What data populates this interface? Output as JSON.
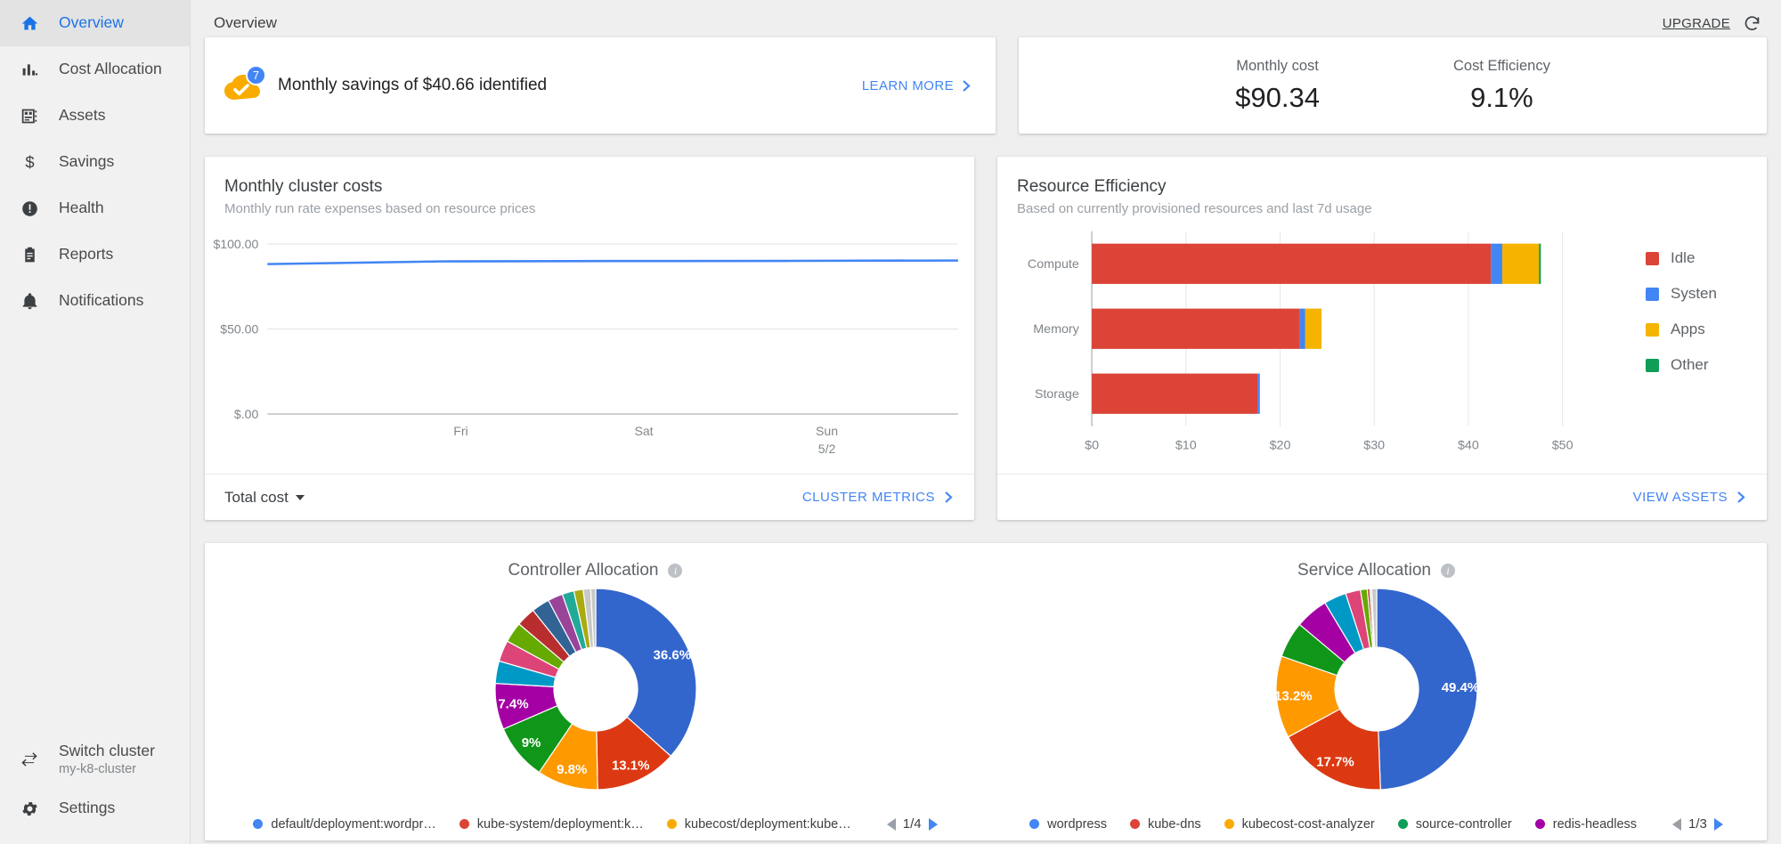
{
  "sidebar": {
    "items": [
      {
        "label": "Overview",
        "icon": "home-icon",
        "active": true
      },
      {
        "label": "Cost Allocation",
        "icon": "bar-chart-icon",
        "active": false
      },
      {
        "label": "Assets",
        "icon": "assets-icon",
        "active": false
      },
      {
        "label": "Savings",
        "icon": "dollar-icon",
        "active": false
      },
      {
        "label": "Health",
        "icon": "alert-icon",
        "active": false
      },
      {
        "label": "Reports",
        "icon": "clipboard-icon",
        "active": false
      },
      {
        "label": "Notifications",
        "icon": "bell-icon",
        "active": false
      }
    ],
    "switch_cluster": {
      "title": "Switch cluster",
      "subtitle": "my-k8-cluster",
      "icon": "swap-arrows-icon"
    },
    "settings": {
      "label": "Settings",
      "icon": "gear-icon"
    }
  },
  "header": {
    "breadcrumb": "Overview",
    "upgrade_label": "UPGRADE",
    "refresh_icon": "refresh-icon"
  },
  "savings": {
    "badge_count": "7",
    "message": "Monthly savings of $40.66 identified",
    "learn_more_label": "LEARN MORE",
    "icon": "cloud-check-icon",
    "badge_color": "#4285f4",
    "cloud_color": "#f9ab00"
  },
  "summary": {
    "metrics": [
      {
        "label": "Monthly cost",
        "value": "$90.34"
      },
      {
        "label": "Cost Efficiency",
        "value": "9.1%"
      }
    ]
  },
  "cluster_costs": {
    "title": "Monthly cluster costs",
    "subtitle": "Monthly run rate expenses based on resource prices",
    "footer_select": "Total cost",
    "footer_link": "CLUSTER METRICS"
  },
  "resource_efficiency": {
    "title": "Resource Efficiency",
    "subtitle": "Based on currently provisioned resources and last 7d usage",
    "footer_link": "VIEW ASSETS"
  },
  "controller_allocation": {
    "title": "Controller Allocation",
    "info_icon": "info-icon",
    "page": "1/4",
    "legend": [
      {
        "label": "default/deployment:wordpr…",
        "color": "#4285f4"
      },
      {
        "label": "kube-system/deployment:k…",
        "color": "#db4437"
      },
      {
        "label": "kubecost/deployment:kube…",
        "color": "#f9ab00"
      }
    ]
  },
  "service_allocation": {
    "title": "Service Allocation",
    "info_icon": "info-icon",
    "page": "1/3",
    "legend": [
      {
        "label": "wordpress",
        "color": "#4285f4"
      },
      {
        "label": "kube-dns",
        "color": "#db4437"
      },
      {
        "label": "kubecost-cost-analyzer",
        "color": "#f9ab00"
      },
      {
        "label": "source-controller",
        "color": "#0f9d58"
      },
      {
        "label": "redis-headless",
        "color": "#a400a4"
      }
    ]
  },
  "chart_data": [
    {
      "type": "line",
      "title": "Monthly cluster costs",
      "subtitle": "Monthly run rate expenses based on resource prices",
      "xlabel": "",
      "ylabel": "",
      "x": [
        "",
        "Fri",
        "Sat",
        "Sun 5/2",
        ""
      ],
      "tick_labels": [
        "Fri",
        "Sat",
        "Sun",
        "5/2"
      ],
      "values": [
        88.2,
        89.8,
        90.0,
        90.1,
        90.34
      ],
      "ylim": [
        0,
        100
      ],
      "yticks": [
        0,
        50,
        100
      ],
      "ytick_labels": [
        "$.00",
        "$50.00",
        "$100.00"
      ],
      "series_color": "#4285f4",
      "grid": true,
      "legend": "none"
    },
    {
      "type": "bar",
      "orientation": "horizontal",
      "stacked": true,
      "title": "Resource Efficiency",
      "subtitle": "Based on currently provisioned resources and last 7d usage",
      "categories": [
        "Compute",
        "Memory",
        "Storage"
      ],
      "series": [
        {
          "name": "Idle",
          "color": "#db4437",
          "values": [
            42.4,
            22.1,
            17.6
          ]
        },
        {
          "name": "Systen",
          "color": "#4285f4",
          "values": [
            1.2,
            0.55,
            0.25
          ]
        },
        {
          "name": "Apps",
          "color": "#f4b400",
          "values": [
            3.9,
            1.75,
            0.0
          ]
        },
        {
          "name": "Other",
          "color": "#0f9d58",
          "values": [
            0.2,
            0.0,
            0.0
          ]
        }
      ],
      "xlim": [
        0,
        55
      ],
      "xticks": [
        0,
        10,
        20,
        30,
        40,
        50
      ],
      "xtick_labels": [
        "$0",
        "$10",
        "$20",
        "$30",
        "$40",
        "$50"
      ],
      "grid": true,
      "legend": "right"
    },
    {
      "type": "pie",
      "variant": "donut",
      "title": "Controller Allocation",
      "labels": [
        "default/deployment:wordpr…",
        "kube-system/deployment:k…",
        "kubecost/deployment:kube…",
        "slice-4",
        "slice-5",
        "slice-6",
        "slice-7",
        "slice-8",
        "slice-9",
        "slice-10",
        "slice-11",
        "slice-12",
        "slice-13",
        "slice-14",
        "slice-15"
      ],
      "values": [
        36.6,
        13.1,
        9.8,
        9.0,
        7.4,
        3.6,
        3.4,
        3.3,
        3.1,
        2.9,
        2.4,
        1.9,
        1.5,
        1.2,
        0.8
      ],
      "shown_labels": [
        "36.6%",
        "13.1%",
        "9.8%",
        "9%",
        "7.4%"
      ],
      "colors": [
        "#3366cc",
        "#dc3912",
        "#ff9900",
        "#109618",
        "#a400a4",
        "#0099c6",
        "#dd4477",
        "#66aa00",
        "#b82e2e",
        "#316395",
        "#994499",
        "#22aa99",
        "#aaaa11",
        "#c8c8c8",
        "#c8c8c8"
      ]
    },
    {
      "type": "pie",
      "variant": "donut",
      "title": "Service Allocation",
      "labels": [
        "wordpress",
        "kube-dns",
        "kubecost-cost-analyzer",
        "source-controller",
        "redis-headless",
        "slice-6",
        "slice-7",
        "slice-8",
        "slice-9",
        "slice-10",
        "slice-11"
      ],
      "values": [
        49.4,
        17.7,
        13.2,
        5.8,
        5.3,
        3.6,
        2.4,
        1.1,
        0.4,
        0.3,
        0.8
      ],
      "shown_labels": [
        "49.4%",
        "17.7%",
        "13.2%"
      ],
      "colors": [
        "#3366cc",
        "#dc3912",
        "#ff9900",
        "#109618",
        "#a400a4",
        "#0099c6",
        "#dd4477",
        "#66aa00",
        "#b82e2e",
        "#c8c8c8",
        "#c8c8c8"
      ]
    }
  ]
}
